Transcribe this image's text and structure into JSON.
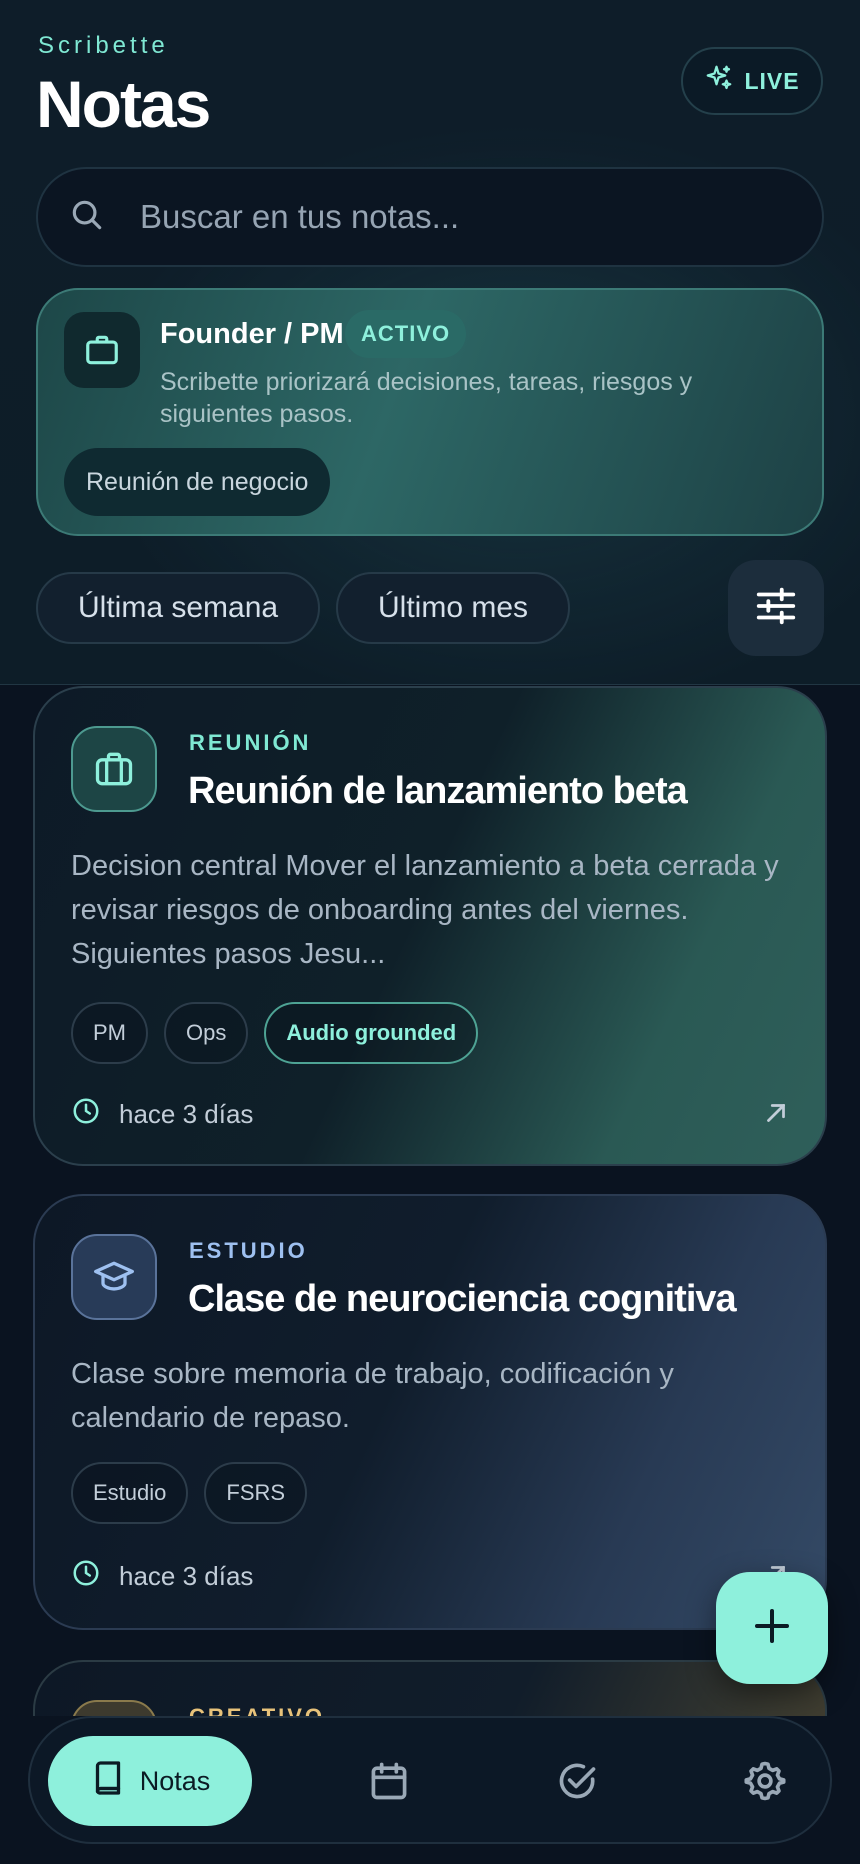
{
  "header": {
    "brand": "Scribette",
    "title": "Notas",
    "live_label": "LIVE"
  },
  "search": {
    "placeholder": "Buscar en tus notas..."
  },
  "profile": {
    "title": "Founder / PM",
    "badge": "ACTIVO",
    "description": "Scribette priorizará decisiones, tareas, riesgos y siguientes pasos.",
    "chip": "Reunión de negocio"
  },
  "filters": {
    "items": [
      "Última semana",
      "Último mes"
    ]
  },
  "notes": [
    {
      "category": "REUNIÓN",
      "title": "Reunión de lanzamiento beta",
      "description": "Decision central Mover el lanzamiento a beta cerrada y revisar riesgos de onboarding antes del viernes. Siguientes pasos Jesu...",
      "tags": [
        "PM",
        "Ops",
        "Audio grounded"
      ],
      "time": "hace 3 días",
      "icon": "briefcase-icon",
      "accent": "#7fe8d3"
    },
    {
      "category": "ESTUDIO",
      "title": "Clase de neurociencia cognitiva",
      "description": "Clase sobre memoria de trabajo, codificación y calendario de repaso.",
      "tags": [
        "Estudio",
        "FSRS"
      ],
      "time": "hace 3 días",
      "icon": "graduation-cap-icon",
      "accent": "#9ec0f0"
    },
    {
      "category": "CREATIVO",
      "icon": "creative-icon",
      "accent": "#e7c27a"
    }
  ],
  "nav": {
    "notas_label": "Notas",
    "items": [
      "calendar-icon",
      "check-circle-icon",
      "gear-icon"
    ]
  },
  "colors": {
    "accent": "#8ef0dc",
    "background": "#0a1320"
  }
}
